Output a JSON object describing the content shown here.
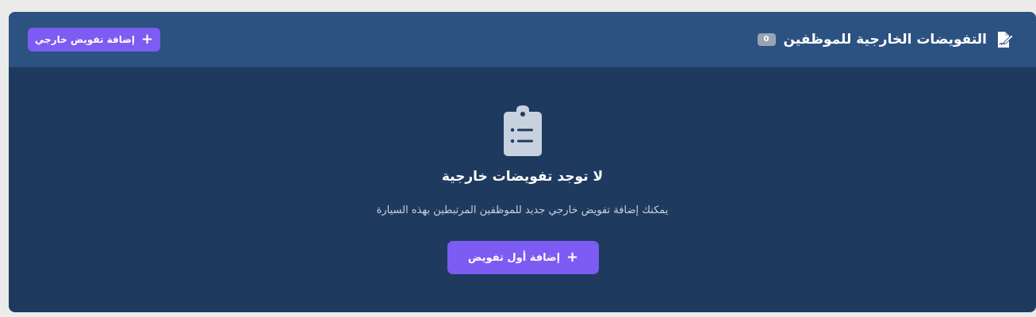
{
  "header": {
    "title": "التفويضات الخارجية للموظفين",
    "count": "0",
    "title_icon": "file-signature-icon",
    "add_button_label": "إضافة تفويض خارجي"
  },
  "empty_state": {
    "icon": "clipboard-list-icon",
    "title": "لا توجد تفويضات خارجية",
    "subtitle": "يمكنك إضافة تفويض خارجي جديد للموظفين المرتبطين بهذه السيارة",
    "button_label": "إضافة أول تفويض"
  },
  "colors": {
    "page_bg": "#ebebeb",
    "card_bg": "#1f3a5f",
    "header_bg": "#2c5282",
    "accent": "#7c5cf2",
    "badge": "#9aa4b1",
    "muted_text": "#c8d2de"
  }
}
